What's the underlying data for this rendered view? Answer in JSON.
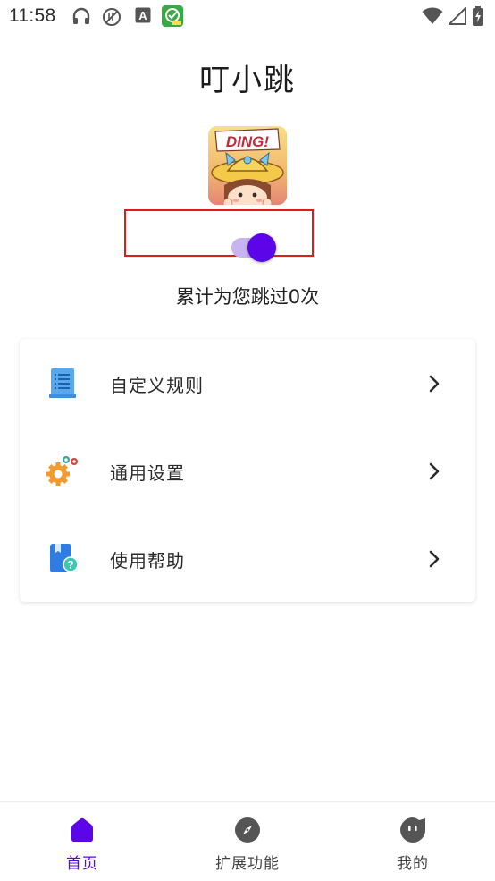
{
  "status_bar": {
    "time": "11:58"
  },
  "app": {
    "title": "叮小跳",
    "logo_text": "DING!"
  },
  "service_toggle": {
    "enabled": true
  },
  "stats": {
    "skip_count_text": "累计为您跳过0次"
  },
  "menu": {
    "items": [
      {
        "label": "自定义规则",
        "icon": "document-list-icon"
      },
      {
        "label": "通用设置",
        "icon": "gears-icon"
      },
      {
        "label": "使用帮助",
        "icon": "help-book-icon"
      }
    ]
  },
  "bottom_nav": {
    "items": [
      {
        "label": "首页",
        "icon": "home-icon",
        "active": true
      },
      {
        "label": "扩展功能",
        "icon": "compass-icon",
        "active": false
      },
      {
        "label": "我的",
        "icon": "profile-face-icon",
        "active": false
      }
    ]
  },
  "colors": {
    "accent": "#5b05e8",
    "toggle_track": "#c9b4f2",
    "highlight_border": "#e11a1a",
    "inactive_nav": "#555555"
  }
}
